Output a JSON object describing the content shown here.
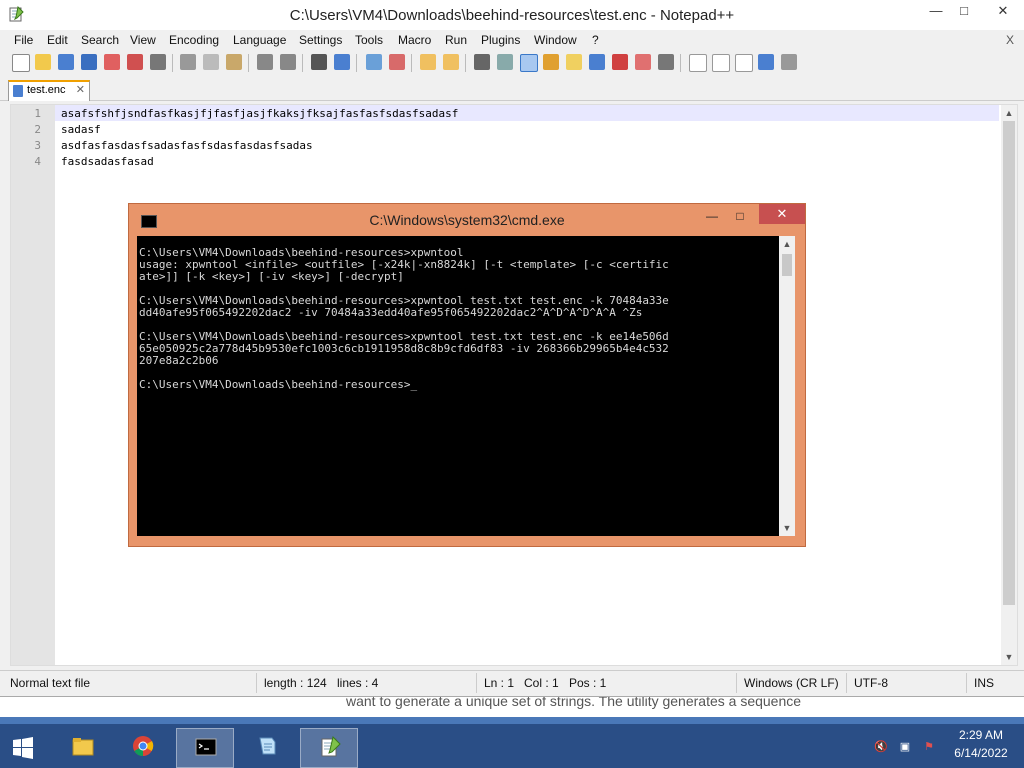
{
  "window": {
    "title": "C:\\Users\\VM4\\Downloads\\beehind-resources\\test.enc - Notepad++",
    "minimize": "—",
    "maximize": "□",
    "close": "✕"
  },
  "menu": [
    "File",
    "Edit",
    "Search",
    "View",
    "Encoding",
    "Language",
    "Settings",
    "Tools",
    "Macro",
    "Run",
    "Plugins",
    "Window",
    "?"
  ],
  "menu_close": "X",
  "tab": {
    "label": "test.enc",
    "close": "✕"
  },
  "editor": {
    "line_numbers": [
      "1",
      "2",
      "3",
      "4"
    ],
    "lines": [
      "asafsfshfjsndfasfkasjfjfasfjasjfkaksjfksajfasfasfsdasfsadasf",
      "sadasf",
      "asdfasfasdasfsadasfasfsdasfasdasfsadas",
      "fasdsadasfasad"
    ]
  },
  "status": {
    "filetype": "Normal text file",
    "length": "length : 124",
    "lines": "lines : 4",
    "ln": "Ln : 1",
    "col": "Col : 1",
    "pos": "Pos : 1",
    "eol": "Windows (CR LF)",
    "encoding": "UTF-8",
    "mode": "INS"
  },
  "background_text": "want to generate a unique set of strings. The utility generates a sequence",
  "cmd": {
    "title": "C:\\Windows\\system32\\cmd.exe",
    "minimize": "—",
    "maximize": "□",
    "close": "✕",
    "lines": [
      "C:\\Users\\VM4\\Downloads\\beehind-resources>xpwntool",
      "usage: xpwntool <infile> <outfile> [-x24k|-xn8824k] [-t <template> [-c <certific",
      "ate>]] [-k <key>] [-iv <key>] [-decrypt]",
      "",
      "C:\\Users\\VM4\\Downloads\\beehind-resources>xpwntool test.txt test.enc -k 70484a33e",
      "dd40afe95f065492202dac2 -iv 70484a33edd40afe95f065492202dac2^A^D^A^D^A^A ^Zs",
      "",
      "C:\\Users\\VM4\\Downloads\\beehind-resources>xpwntool test.txt test.enc -k ee14e506d",
      "65e050925c2a778d45b9530efc1003c6cb1911958d8c8b9cfd6df83 -iv 268366b29965b4e4c532",
      "207e8a2c2b06",
      "",
      "C:\\Users\\VM4\\Downloads\\beehind-resources>_"
    ]
  },
  "taskbar": {
    "time": "2:29 AM",
    "date": "6/14/2022"
  },
  "colors": {
    "cmd_frame": "#e8956a",
    "taskbar": "#2a4e86",
    "current_line": "#e8e8ff"
  }
}
